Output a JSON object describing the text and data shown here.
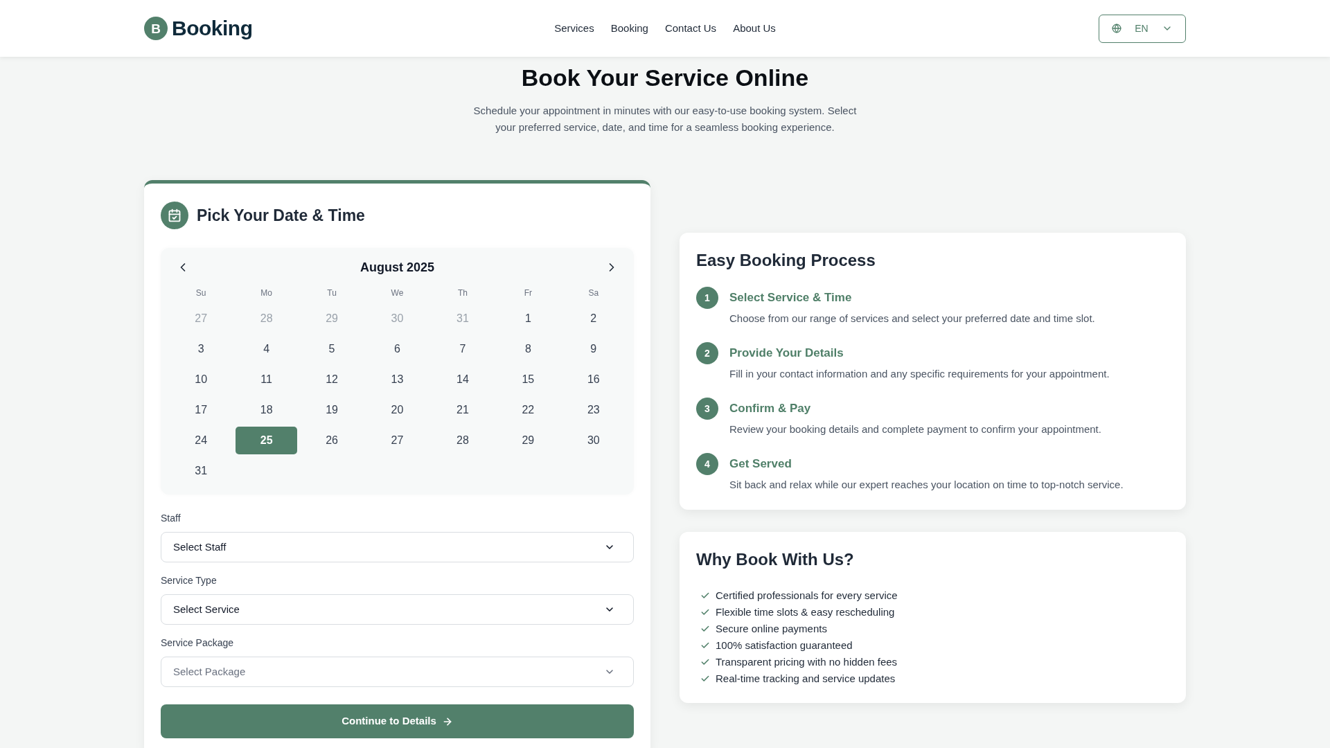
{
  "header": {
    "logo": {
      "letter": "B",
      "name": "Booking"
    },
    "nav": [
      {
        "label": "Services",
        "selected": false
      },
      {
        "label": "Booking",
        "selected": false
      },
      {
        "label": "Contact Us",
        "selected": false
      },
      {
        "label": "About Us",
        "selected": false
      }
    ],
    "language": {
      "code": "EN"
    }
  },
  "hero": {
    "title": "Book Your Service Online",
    "description": "Schedule your appointment in minutes with our easy-to-use booking system. Select your preferred service, date, and time for a seamless booking experience."
  },
  "booking_card": {
    "title": "Pick Your Date & Time",
    "calendar": {
      "month": "August 2025",
      "weekdays": [
        "Su",
        "Mo",
        "Tu",
        "We",
        "Th",
        "Fr",
        "Sa"
      ],
      "days": [
        {
          "label": "27",
          "other_month": true,
          "selected": false
        },
        {
          "label": "28",
          "other_month": true,
          "selected": false
        },
        {
          "label": "29",
          "other_month": true,
          "selected": false
        },
        {
          "label": "30",
          "other_month": true,
          "selected": false
        },
        {
          "label": "31",
          "other_month": true,
          "selected": false
        },
        {
          "label": "1",
          "other_month": false,
          "selected": false
        },
        {
          "label": "2",
          "other_month": false,
          "selected": false
        },
        {
          "label": "3",
          "other_month": false,
          "selected": false
        },
        {
          "label": "4",
          "other_month": false,
          "selected": false
        },
        {
          "label": "5",
          "other_month": false,
          "selected": false
        },
        {
          "label": "6",
          "other_month": false,
          "selected": false
        },
        {
          "label": "7",
          "other_month": false,
          "selected": false
        },
        {
          "label": "8",
          "other_month": false,
          "selected": false
        },
        {
          "label": "9",
          "other_month": false,
          "selected": false
        },
        {
          "label": "10",
          "other_month": false,
          "selected": false
        },
        {
          "label": "11",
          "other_month": false,
          "selected": false
        },
        {
          "label": "12",
          "other_month": false,
          "selected": false
        },
        {
          "label": "13",
          "other_month": false,
          "selected": false
        },
        {
          "label": "14",
          "other_month": false,
          "selected": false
        },
        {
          "label": "15",
          "other_month": false,
          "selected": false
        },
        {
          "label": "16",
          "other_month": false,
          "selected": false
        },
        {
          "label": "17",
          "other_month": false,
          "selected": false
        },
        {
          "label": "18",
          "other_month": false,
          "selected": false
        },
        {
          "label": "19",
          "other_month": false,
          "selected": false
        },
        {
          "label": "20",
          "other_month": false,
          "selected": false
        },
        {
          "label": "21",
          "other_month": false,
          "selected": false
        },
        {
          "label": "22",
          "other_month": false,
          "selected": false
        },
        {
          "label": "23",
          "other_month": false,
          "selected": false
        },
        {
          "label": "24",
          "other_month": false,
          "selected": false
        },
        {
          "label": "25",
          "other_month": false,
          "selected": true
        },
        {
          "label": "26",
          "other_month": false,
          "selected": false
        },
        {
          "label": "27",
          "other_month": false,
          "selected": false
        },
        {
          "label": "28",
          "other_month": false,
          "selected": false
        },
        {
          "label": "29",
          "other_month": false,
          "selected": false
        },
        {
          "label": "30",
          "other_month": false,
          "selected": false
        },
        {
          "label": "31",
          "other_month": false,
          "selected": false
        }
      ]
    },
    "fields": [
      {
        "label": "Staff",
        "value": "Select Staff",
        "disabled": false
      },
      {
        "label": "Service Type",
        "value": "Select Service",
        "disabled": false
      },
      {
        "label": "Service Package",
        "value": "Select Package",
        "disabled": true
      }
    ],
    "button": {
      "label": "Continue to Details"
    }
  },
  "process_card": {
    "title": "Easy Booking Process",
    "steps": [
      {
        "number": "1",
        "title": "Select Service & Time",
        "description": "Choose from our range of services and select your preferred date and time slot."
      },
      {
        "number": "2",
        "title": "Provide Your Details",
        "description": "Fill in your contact information and any specific requirements for your appointment."
      },
      {
        "number": "3",
        "title": "Confirm & Pay",
        "description": "Review your booking details and complete payment to confirm your appointment."
      },
      {
        "number": "4",
        "title": "Get Served",
        "description": "Sit back and relax while our expert reaches your location on time to top-notch service."
      }
    ]
  },
  "why_card": {
    "title": "Why Book With Us?",
    "items": [
      "Certified professionals for every service",
      "Flexible time slots & easy rescheduling",
      "Secure online payments",
      "100% satisfaction guaranteed",
      "Transparent pricing with no hidden fees",
      "Real-time tracking and service updates"
    ]
  }
}
